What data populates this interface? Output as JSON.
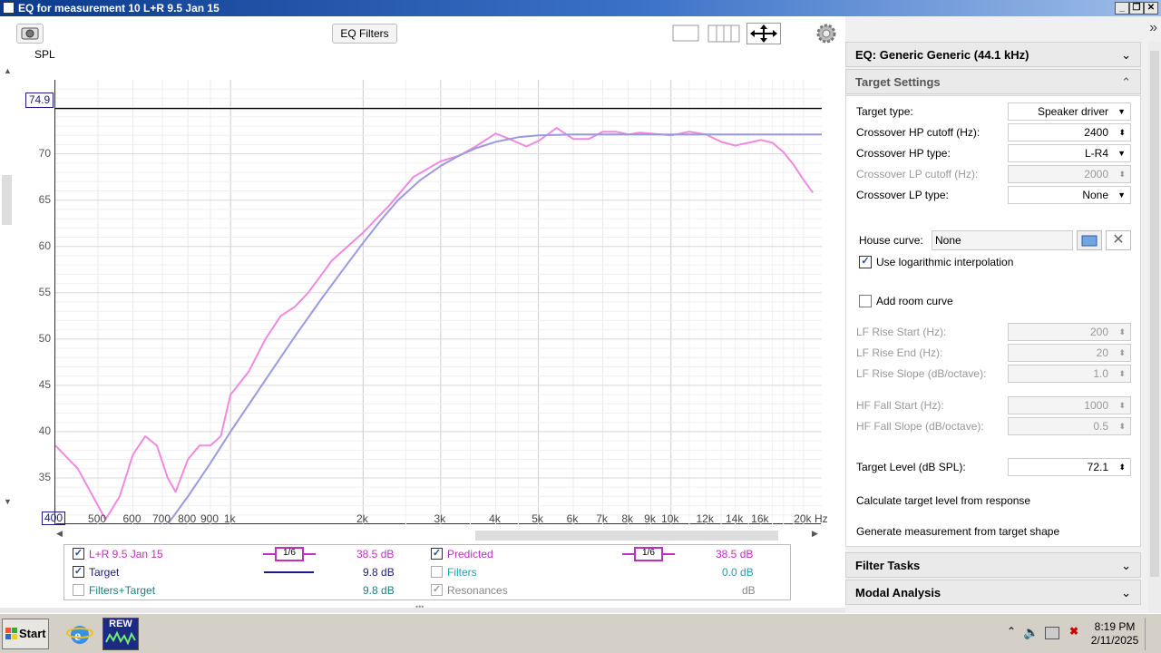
{
  "window": {
    "title": "EQ for measurement 10 L+R 9.5 Jan 15"
  },
  "toolbar": {
    "eq_filters_label": "EQ Filters"
  },
  "plot": {
    "y_axis_label": "SPL",
    "cursor_value": "74.9",
    "x_start_value": "400",
    "x_unit": "Hz",
    "y_ticks": [
      "70",
      "65",
      "60",
      "55",
      "50",
      "45",
      "40",
      "35"
    ],
    "x_ticks": [
      "500",
      "600",
      "700",
      "800",
      "900",
      "1k",
      "2k",
      "3k",
      "4k",
      "5k",
      "6k",
      "7k",
      "8k",
      "9k",
      "10k",
      "12k",
      "14k",
      "16k",
      "20k"
    ]
  },
  "chart_data": {
    "type": "line",
    "xlabel": "Hz",
    "ylabel": "SPL",
    "x_scale": "log",
    "xlim": [
      400,
      22000
    ],
    "ylim": [
      30,
      78
    ],
    "grid": true,
    "cursor_y": 74.9,
    "series": [
      {
        "name": "L+R 9.5 Jan 15",
        "color": "#f08ae0",
        "x": [
          400,
          450,
          500,
          520,
          560,
          600,
          640,
          680,
          720,
          750,
          800,
          850,
          900,
          950,
          1000,
          1100,
          1200,
          1300,
          1400,
          1500,
          1700,
          2000,
          2300,
          2600,
          3000,
          3300,
          3600,
          4000,
          4300,
          4700,
          5000,
          5500,
          6000,
          6500,
          7000,
          7500,
          8000,
          8500,
          9000,
          9500,
          10000,
          11000,
          12000,
          13000,
          14000,
          15000,
          16000,
          17000,
          18000,
          19000,
          20000,
          21000
        ],
        "y": [
          38.5,
          36,
          32,
          30.5,
          33,
          37.5,
          39.5,
          38.5,
          35,
          33.5,
          37,
          38.5,
          38.5,
          39.5,
          44,
          46.5,
          50,
          52.5,
          53.5,
          55,
          58.5,
          61.5,
          64.5,
          67.5,
          69.2,
          69.8,
          70.8,
          72.2,
          71.6,
          70.8,
          71.4,
          72.8,
          71.6,
          71.6,
          72.4,
          72.4,
          72.1,
          72.3,
          72.2,
          72.1,
          72.0,
          72.4,
          72.1,
          71.3,
          70.9,
          71.2,
          71.5,
          71.2,
          70.2,
          68.8,
          67.2,
          65.8
        ]
      },
      {
        "name": "Target",
        "color": "#9a9ae0",
        "x": [
          720,
          800,
          900,
          1000,
          1200,
          1400,
          1600,
          1800,
          2000,
          2200,
          2400,
          2700,
          3000,
          3300,
          3600,
          4000,
          4500,
          5000,
          6000,
          7000,
          8000,
          10000,
          12000,
          15000,
          20000,
          22000
        ],
        "y": [
          30,
          33,
          36.6,
          40,
          45.6,
          50.3,
          54.2,
          57.5,
          60.4,
          62.9,
          65.0,
          67.2,
          68.7,
          69.8,
          70.6,
          71.3,
          71.8,
          72.0,
          72.1,
          72.1,
          72.1,
          72.1,
          72.1,
          72.1,
          72.1,
          72.1
        ]
      }
    ]
  },
  "legend": {
    "items": [
      {
        "label": "L+R 9.5 Jan 15",
        "checked": true,
        "value": "38.5 dB",
        "smoothing": "1/6",
        "color": "#c030c0"
      },
      {
        "label": "Predicted",
        "checked": true,
        "value": "38.5 dB",
        "smoothing": "1/6",
        "color": "#c030c0"
      },
      {
        "label": "Target",
        "checked": true,
        "value": "9.8 dB",
        "color": "#1a1a80"
      },
      {
        "label": "Filters",
        "checked": false,
        "value": "0.0 dB",
        "color": "#22a0b0"
      },
      {
        "label": "Filters+Target",
        "checked": false,
        "value": "9.8 dB",
        "color": "#1a8080"
      },
      {
        "label": "Resonances",
        "checked": true,
        "value": "dB",
        "color": "#888888"
      }
    ]
  },
  "side": {
    "eq_title": "EQ: Generic Generic (44.1 kHz)",
    "target_title": "Target Settings",
    "target_type_label": "Target type:",
    "target_type": "Speaker driver",
    "hp_cutoff_label": "Crossover HP cutoff (Hz):",
    "hp_cutoff": "2400",
    "hp_type_label": "Crossover HP type:",
    "hp_type": "L-R4",
    "lp_cutoff_label": "Crossover LP cutoff (Hz):",
    "lp_cutoff": "2000",
    "lp_type_label": "Crossover LP type:",
    "lp_type": "None",
    "house_label": "House curve:",
    "house_value": "None",
    "log_interp_label": "Use logarithmic interpolation",
    "room_curve_label": "Add room curve",
    "lf_start_label": "LF Rise Start (Hz):",
    "lf_start": "200",
    "lf_end_label": "LF Rise End (Hz):",
    "lf_end": "20",
    "lf_slope_label": "LF Rise Slope (dB/octave):",
    "lf_slope": "1.0",
    "hf_start_label": "HF Fall Start (Hz):",
    "hf_start": "1000",
    "hf_slope_label": "HF Fall Slope (dB/octave):",
    "hf_slope": "0.5",
    "level_label": "Target Level (dB SPL):",
    "level": "72.1",
    "calc_label": "Calculate target level from response",
    "gen_label": "Generate measurement from target shape",
    "filter_tasks": "Filter Tasks",
    "modal": "Modal Analysis"
  },
  "taskbar": {
    "start": "Start",
    "time": "8:19 PM",
    "date": "2/11/2025",
    "rew": "REW"
  }
}
